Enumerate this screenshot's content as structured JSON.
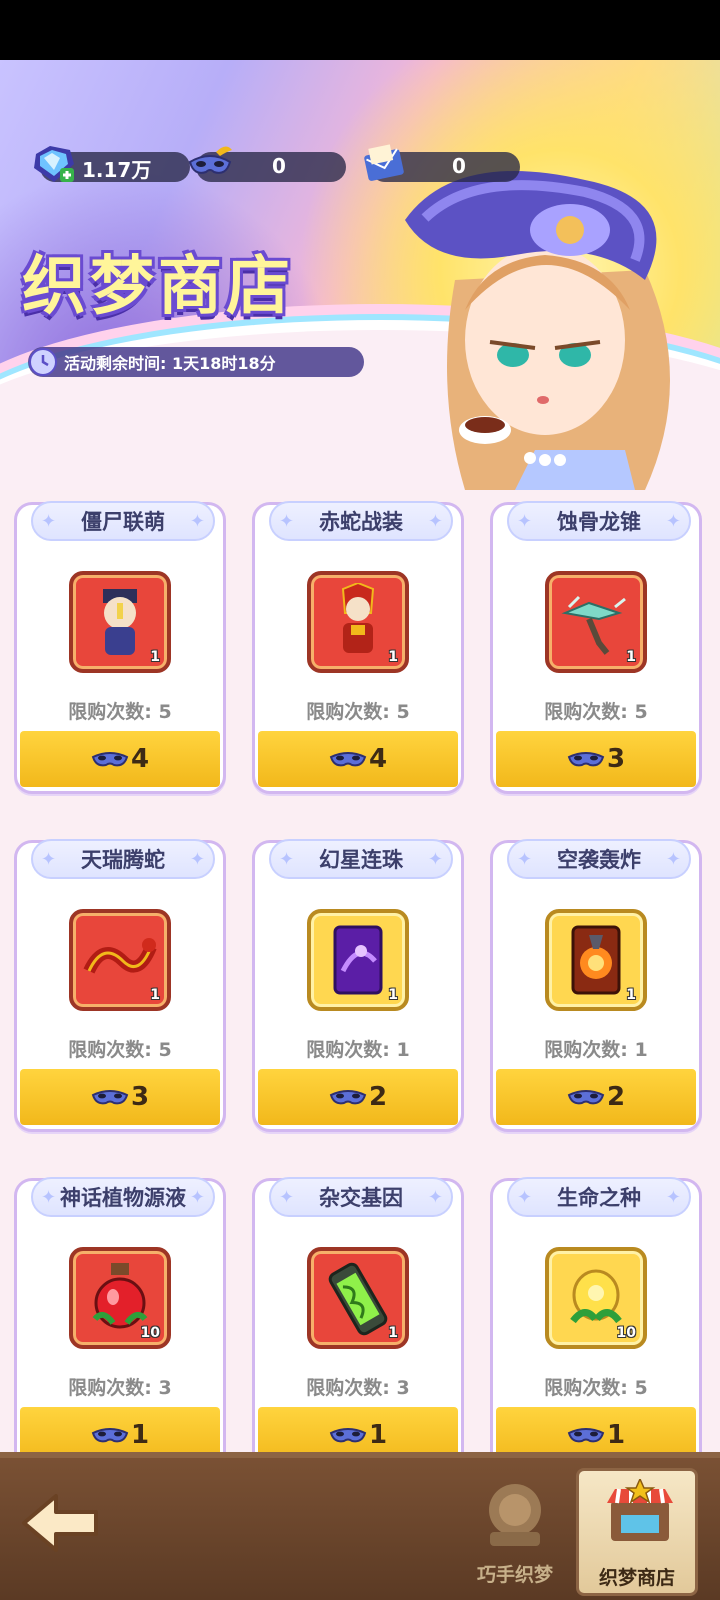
{
  "header": {
    "currencies": [
      {
        "name": "diamond",
        "value": "1.17万",
        "icon": "diamond-plus-icon"
      },
      {
        "name": "mask",
        "value": "0",
        "icon": "masquerade-mask-icon"
      },
      {
        "name": "envelope",
        "value": "0",
        "icon": "letter-envelope-icon"
      }
    ],
    "title": "织梦商店",
    "timer_label": "活动剩余时间: ",
    "timer_value": "1天18时18分"
  },
  "shop": {
    "items": [
      {
        "name": "僵尸联萌",
        "count": "1",
        "limit": "限购次数: 5",
        "price": "4",
        "frame": "red",
        "icon": "zombie-character-icon"
      },
      {
        "name": "赤蛇战装",
        "count": "1",
        "limit": "限购次数: 5",
        "price": "4",
        "frame": "red",
        "icon": "red-snake-warrior-icon"
      },
      {
        "name": "蚀骨龙锥",
        "count": "1",
        "limit": "限购次数: 5",
        "price": "3",
        "frame": "red",
        "icon": "bone-dragon-weapon-icon"
      },
      {
        "name": "天瑞腾蛇",
        "count": "1",
        "limit": "限购次数: 5",
        "price": "3",
        "frame": "red",
        "icon": "soaring-snake-icon"
      },
      {
        "name": "幻星连珠",
        "count": "1",
        "limit": "限购次数: 1",
        "price": "2",
        "frame": "gold",
        "icon": "purple-star-card-icon"
      },
      {
        "name": "空袭轰炸",
        "count": "1",
        "limit": "限购次数: 1",
        "price": "2",
        "frame": "gold",
        "icon": "airstrike-card-icon"
      },
      {
        "name": "神话植物源液",
        "count": "10",
        "limit": "限购次数: 3",
        "price": "1",
        "frame": "red",
        "icon": "potion-bottle-icon"
      },
      {
        "name": "杂交基因",
        "count": "1",
        "limit": "限购次数: 3",
        "price": "1",
        "frame": "red",
        "icon": "gene-capsule-icon"
      },
      {
        "name": "生命之种",
        "count": "10",
        "limit": "限购次数: 5",
        "price": "1",
        "frame": "gold",
        "icon": "life-seed-icon"
      }
    ]
  },
  "footer": {
    "tabs": [
      {
        "label": "巧手织梦",
        "icon": "weaving-workshop-icon",
        "active": false
      },
      {
        "label": "织梦商店",
        "icon": "shop-stall-icon",
        "active": true
      }
    ]
  },
  "colors": {
    "title": "#fff59a",
    "price_bar": "#f2b81b",
    "card_border": "#d2b7f0",
    "page_bg": "#fbeef3"
  }
}
